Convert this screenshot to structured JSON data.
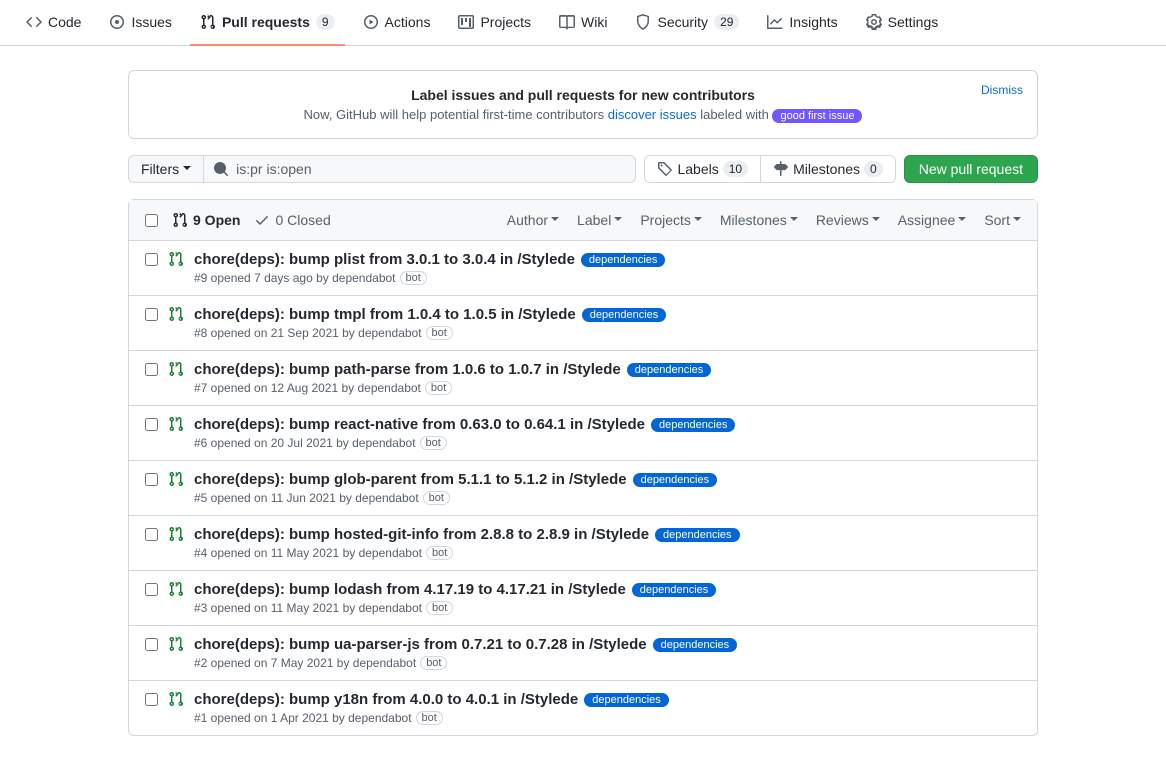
{
  "nav": {
    "code": "Code",
    "issues": "Issues",
    "pulls": "Pull requests",
    "pulls_count": "9",
    "actions": "Actions",
    "projects": "Projects",
    "wiki": "Wiki",
    "security": "Security",
    "security_count": "29",
    "insights": "Insights",
    "settings": "Settings"
  },
  "banner": {
    "title": "Label issues and pull requests for new contributors",
    "sub_pre": "Now, GitHub will help potential first-time contributors ",
    "discover": "discover issues",
    "sub_post": " labeled with ",
    "gfi": "good first issue",
    "dismiss": "Dismiss"
  },
  "toolbar": {
    "filters": "Filters",
    "search_value": "is:pr is:open",
    "labels": "Labels",
    "labels_count": "10",
    "milestones": "Milestones",
    "milestones_count": "0",
    "new_pr": "New pull request"
  },
  "header": {
    "open": "9 Open",
    "closed": "0 Closed",
    "dropdowns": [
      "Author",
      "Label",
      "Projects",
      "Milestones",
      "Reviews",
      "Assignee",
      "Sort"
    ]
  },
  "label_dep": "dependencies",
  "bot": "bot",
  "prs": [
    {
      "title": "chore(deps): bump plist from 3.0.1 to 3.0.4 in /Stylede",
      "meta": "#9 opened 7 days ago by dependabot"
    },
    {
      "title": "chore(deps): bump tmpl from 1.0.4 to 1.0.5 in /Stylede",
      "meta": "#8 opened on 21 Sep 2021 by dependabot"
    },
    {
      "title": "chore(deps): bump path-parse from 1.0.6 to 1.0.7 in /Stylede",
      "meta": "#7 opened on 12 Aug 2021 by dependabot"
    },
    {
      "title": "chore(deps): bump react-native from 0.63.0 to 0.64.1 in /Stylede",
      "meta": "#6 opened on 20 Jul 2021 by dependabot"
    },
    {
      "title": "chore(deps): bump glob-parent from 5.1.1 to 5.1.2 in /Stylede",
      "meta": "#5 opened on 11 Jun 2021 by dependabot"
    },
    {
      "title": "chore(deps): bump hosted-git-info from 2.8.8 to 2.8.9 in /Stylede",
      "meta": "#4 opened on 11 May 2021 by dependabot"
    },
    {
      "title": "chore(deps): bump lodash from 4.17.19 to 4.17.21 in /Stylede",
      "meta": "#3 opened on 11 May 2021 by dependabot"
    },
    {
      "title": "chore(deps): bump ua-parser-js from 0.7.21 to 0.7.28 in /Stylede",
      "meta": "#2 opened on 7 May 2021 by dependabot"
    },
    {
      "title": "chore(deps): bump y18n from 4.0.0 to 4.0.1 in /Stylede",
      "meta": "#1 opened on 1 Apr 2021 by dependabot"
    }
  ]
}
